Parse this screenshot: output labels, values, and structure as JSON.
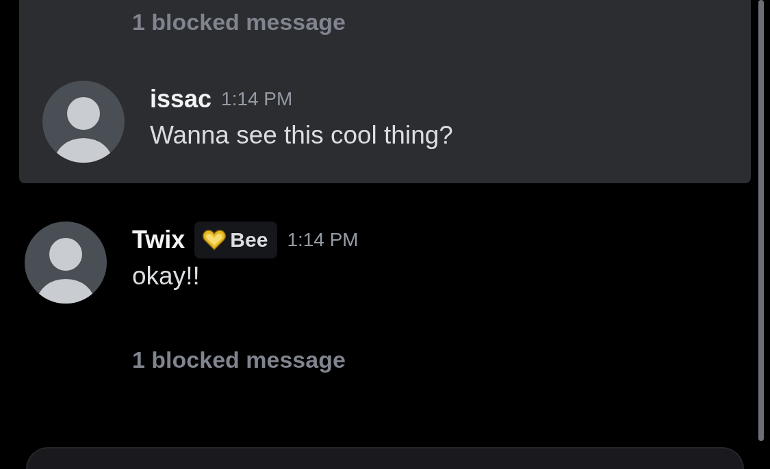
{
  "highlighted_group": {
    "items": [
      {
        "kind": "blocked",
        "text": "1 blocked message"
      },
      {
        "kind": "message",
        "author": "issac",
        "time": "1:14 PM",
        "text": "Wanna see this cool thing?"
      }
    ]
  },
  "items": [
    {
      "kind": "message",
      "author": "Twix",
      "badge": {
        "label": "Bee"
      },
      "time": "1:14 PM",
      "text": "okay!!"
    },
    {
      "kind": "blocked",
      "text": "1 blocked message"
    }
  ]
}
